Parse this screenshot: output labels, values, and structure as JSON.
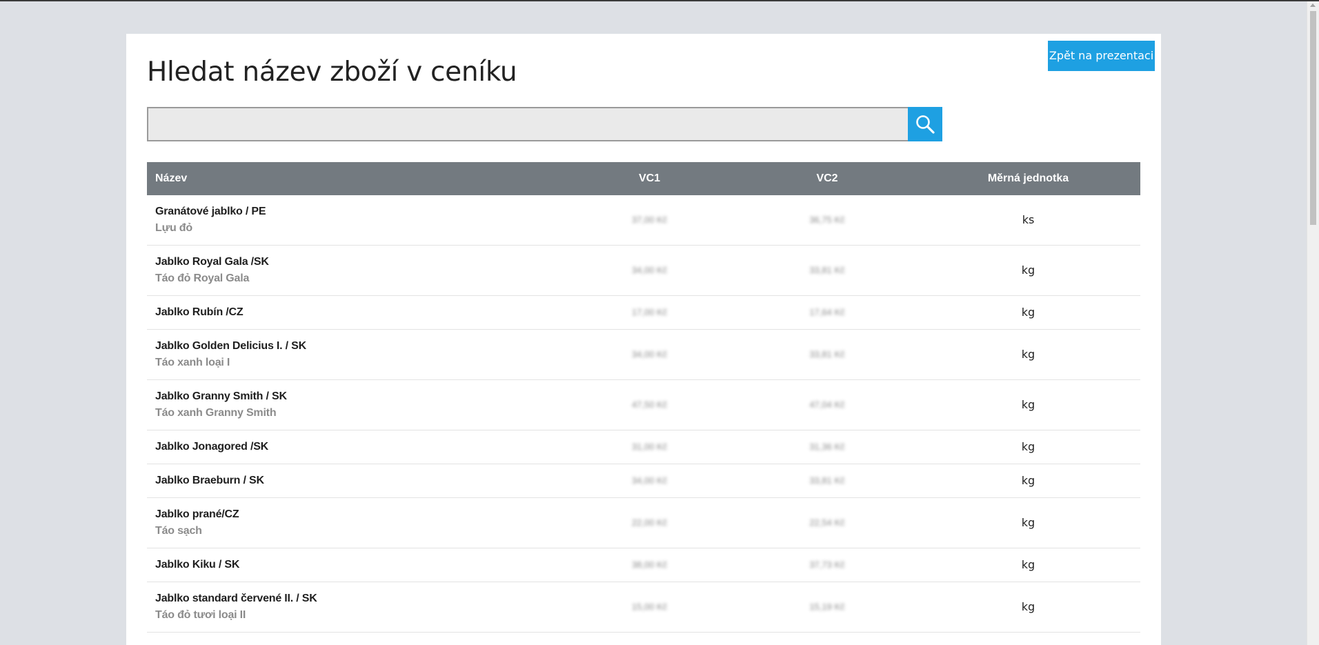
{
  "header": {
    "title": "Hledat název zboží v ceníku",
    "back_button": "Zpět na prezentaci"
  },
  "search": {
    "value": "",
    "placeholder": "",
    "button_icon": "search-icon"
  },
  "table": {
    "headers": {
      "name": "Název",
      "vc1": "VC1",
      "vc2": "VC2",
      "unit": "Měrná jednotka"
    },
    "rows": [
      {
        "name": "Granátové jablko / PE",
        "subname": "Lựu đỏ",
        "vc1": "37,00 Kč",
        "vc2": "36,75 Kč",
        "unit": "ks"
      },
      {
        "name": "Jablko Royal Gala /SK",
        "subname": "Táo đỏ Royal Gala",
        "vc1": "34,00 Kč",
        "vc2": "33,81 Kč",
        "unit": "kg"
      },
      {
        "name": "Jablko Rubín /CZ",
        "subname": "",
        "vc1": "17,00 Kč",
        "vc2": "17,64 Kč",
        "unit": "kg"
      },
      {
        "name": "Jablko Golden Delicius I. / SK",
        "subname": "Táo xanh loại I",
        "vc1": "34,00 Kč",
        "vc2": "33,81 Kč",
        "unit": "kg"
      },
      {
        "name": "Jablko Granny Smith / SK",
        "subname": "Táo xanh Granny Smith",
        "vc1": "47,50 Kč",
        "vc2": "47,04 Kč",
        "unit": "kg"
      },
      {
        "name": "Jablko Jonagored /SK",
        "subname": "",
        "vc1": "31,00 Kč",
        "vc2": "31,36 Kč",
        "unit": "kg"
      },
      {
        "name": "Jablko Braeburn / SK",
        "subname": "",
        "vc1": "34,00 Kč",
        "vc2": "33,81 Kč",
        "unit": "kg"
      },
      {
        "name": "Jablko prané/CZ",
        "subname": "Táo sạch",
        "vc1": "22,00 Kč",
        "vc2": "22,54 Kč",
        "unit": "kg"
      },
      {
        "name": "Jablko Kiku / SK",
        "subname": "",
        "vc1": "38,00 Kč",
        "vc2": "37,73 Kč",
        "unit": "kg"
      },
      {
        "name": "Jablko standard červené II. / SK",
        "subname": "Táo đỏ tươi loại II",
        "vc1": "15,00 Kč",
        "vc2": "15,19 Kč",
        "unit": "kg"
      }
    ]
  },
  "colors": {
    "accent": "#1ea0e2",
    "table_header_bg": "#737a80",
    "page_bg": "#dde0e5",
    "subname_text": "#8b8b8b"
  }
}
